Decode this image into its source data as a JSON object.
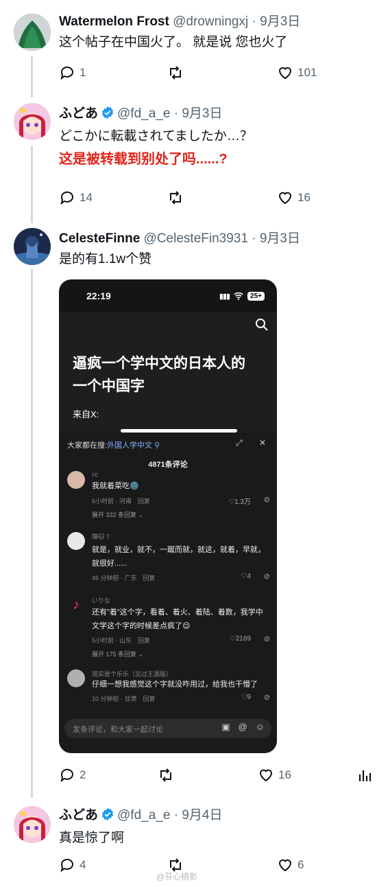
{
  "tweets": [
    {
      "name": "Watermelon Frost",
      "handle": "@drowningxj",
      "dot": "·",
      "date": "9月3日",
      "text": "这个帖子在中国火了。 就是说 您也火了",
      "replies": "1",
      "likes": "101"
    },
    {
      "name": "ふどあ",
      "handle": "@fd_a_e",
      "dot": "·",
      "date": "9月3日",
      "text": "どこかに転載されてましたか…？",
      "annotation": "这是被转载到别处了吗......?",
      "replies": "14",
      "likes": "16"
    },
    {
      "name": "CelesteFinne",
      "handle": "@CelesteFin3931",
      "dot": "·",
      "date": "9月3日",
      "text": "是的有1.1w个赞",
      "replies": "2",
      "likes": "16"
    },
    {
      "name": "ふどあ",
      "handle": "@fd_a_e",
      "dot": "·",
      "date": "9月4日",
      "text": "真是惊了啊",
      "replies": "4",
      "likes": "6"
    }
  ],
  "phone": {
    "time": "22:19",
    "battery": "25+",
    "title": "逼疯一个学中文的日本人的一个中国字",
    "from": "来自X:",
    "hot_prefix": "大家都在搜:",
    "hot_term": "外国人学中文",
    "comment_count": "4871条评论",
    "comments": [
      {
        "user": "cc",
        "text": "我就着菜吃🌚",
        "meta": "6小时前 · 河南　回复",
        "likes": "♡1.3万",
        "expand": "展开 332 条回复 ⌄"
      },
      {
        "user": "陳🐱 7",
        "text": "就是，就业，就不，一蹴而就，就这，就着，早就，就很好......",
        "meta": "46 分钟前 · 广东　回复",
        "likes": "♡4"
      },
      {
        "user": "いりな",
        "text": "还有\"着\"这个字，看着、着火、着陆、着数，我学中文学这个字的时候差点疯了😌",
        "meta": "5小时前 · 山东　回复",
        "likes": "♡2169",
        "expand": "展开 175 条回复 ⌄"
      },
      {
        "user": "现实是个乐乐（见过王源版）",
        "text": "仔细一想我感觉这个字就没咋用过，给我也干懵了",
        "meta": "10 分钟前 · 甘肃　回复",
        "likes": "♡9"
      }
    ],
    "input_placeholder": "发条评论，和大家一起讨论"
  },
  "watermark": "@芬心摘影",
  "colors": {
    "accent_red": "#e0241b",
    "verified_blue": "#1d9bf0",
    "gray_text": "#536471"
  }
}
